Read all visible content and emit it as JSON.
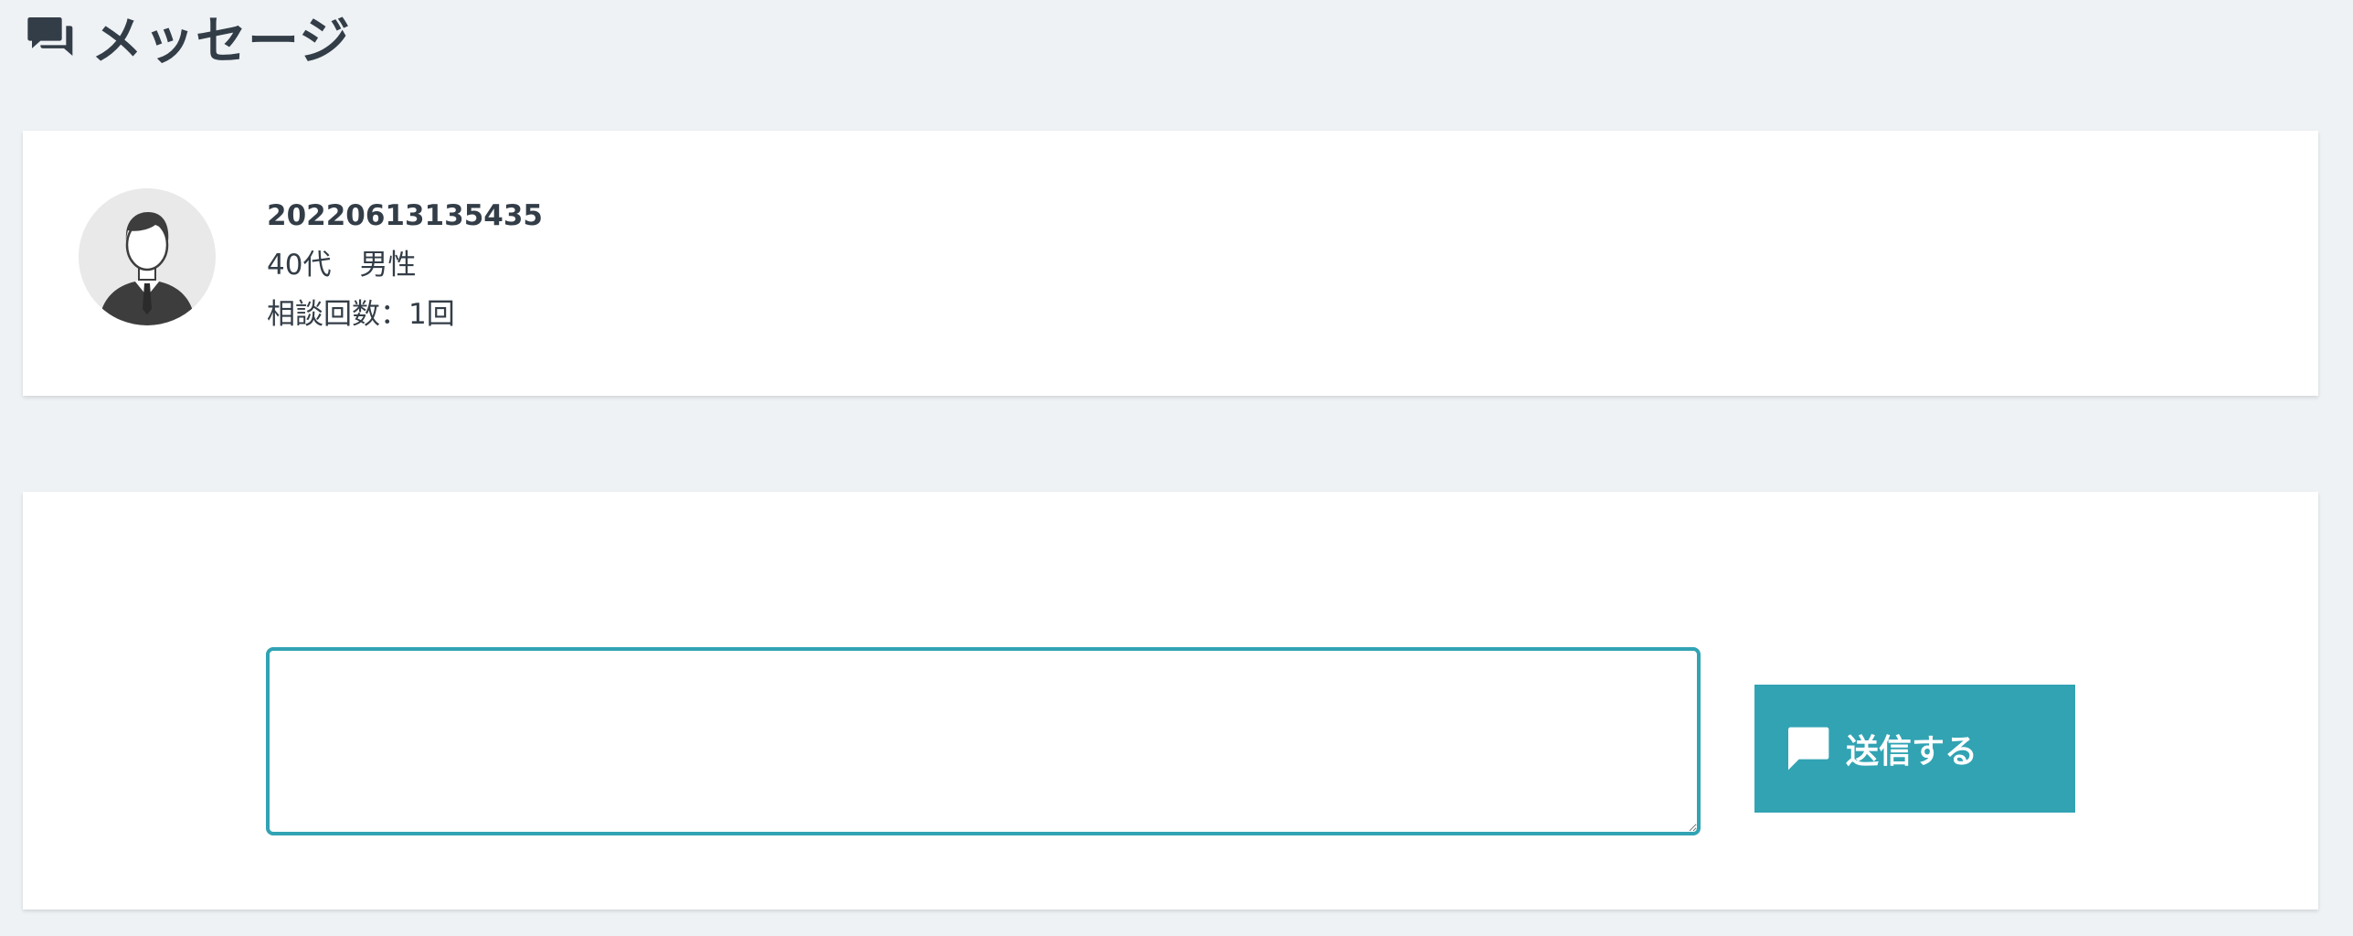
{
  "header": {
    "title": "メッセージ",
    "icon": "chat-bubbles-icon"
  },
  "profile": {
    "avatar_icon": "user-avatar-icon",
    "user_id": "20220613135435",
    "age_gender": "40代　男性",
    "consultation_count": "相談回数：1回"
  },
  "compose": {
    "textarea_value": "",
    "send_label": "送信する",
    "send_icon": "chat-bubble-icon"
  },
  "colors": {
    "accent": "#31a3b3",
    "background": "#eef2f5",
    "text": "#333d47"
  }
}
